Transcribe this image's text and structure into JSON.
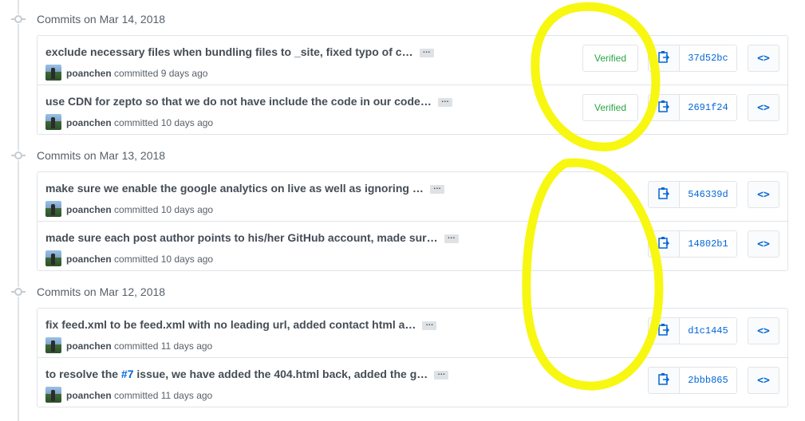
{
  "days": [
    {
      "title": "Commits on Mar 14, 2018",
      "commits": [
        {
          "message": "exclude necessary files when bundling files to _site, fixed typo of c…",
          "author": "poanchen",
          "action": "committed",
          "time": "9 days ago",
          "verified": "Verified",
          "sha": "37d52bc"
        },
        {
          "message": "use CDN for zepto so that we do not have include the code in our code…",
          "author": "poanchen",
          "action": "committed",
          "time": "10 days ago",
          "verified": "Verified",
          "sha": "2691f24"
        }
      ]
    },
    {
      "title": "Commits on Mar 13, 2018",
      "commits": [
        {
          "message": "make sure we enable the google analytics on live as well as ignoring …",
          "author": "poanchen",
          "action": "committed",
          "time": "10 days ago",
          "sha": "546339d"
        },
        {
          "message": "made sure each post author points to his/her GitHub account, made sur…",
          "author": "poanchen",
          "action": "committed",
          "time": "10 days ago",
          "sha": "14802b1"
        }
      ]
    },
    {
      "title": "Commits on Mar 12, 2018",
      "commits": [
        {
          "message": "fix feed.xml to be feed.xml with no leading url, added contact html a…",
          "author": "poanchen",
          "action": "committed",
          "time": "11 days ago",
          "sha": "d1c1445"
        },
        {
          "message_prefix": "to resolve the ",
          "message_link": "#7",
          "message_suffix": " issue, we have added the 404.html back, added the g…",
          "author": "poanchen",
          "action": "committed",
          "time": "11 days ago",
          "sha": "2bbb865"
        }
      ]
    }
  ],
  "ellipsis_label": "…",
  "browse_label": "<>",
  "colors": {
    "verified": "#28a745",
    "sha": "#0366d6",
    "highlight": "#f7f712"
  },
  "icons": {
    "copy": "clipboard-icon",
    "browse": "code-icon",
    "day": "git-commit-icon"
  }
}
